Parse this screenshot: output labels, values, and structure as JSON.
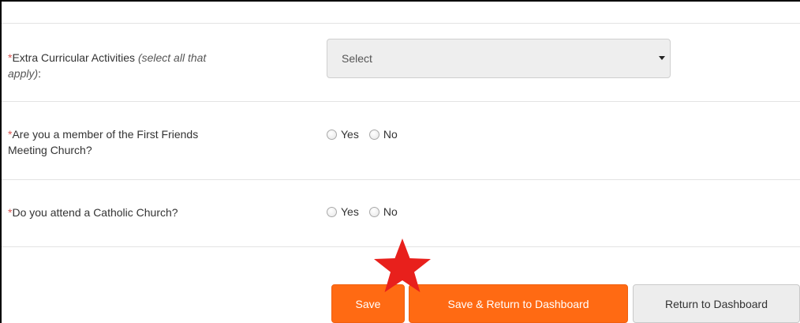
{
  "form": {
    "required_mark": "*",
    "extracurricular": {
      "label": "Extra Curricular Activities",
      "hint_line1": "(select all that",
      "hint_line2": "apply)",
      "suffix": ":",
      "selected": "Select"
    },
    "friends_church": {
      "label_line1": "Are you a member of the First Friends",
      "label_line2": "Meeting Church?",
      "options": [
        "Yes",
        "No"
      ]
    },
    "catholic_church": {
      "label": "Do you attend a Catholic Church?",
      "options": [
        "Yes",
        "No"
      ]
    }
  },
  "actions": {
    "save_label": "Save",
    "save_return_label": "Save & Return to Dashboard",
    "return_label": "Return to Dashboard"
  },
  "colors": {
    "accent": "#ff6a13",
    "required": "#d9534f",
    "star": "#e8201c"
  }
}
